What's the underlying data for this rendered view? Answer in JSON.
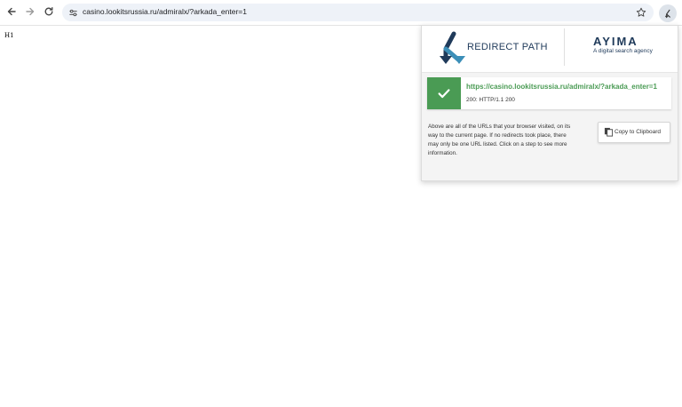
{
  "browser": {
    "url": "casino.lookitsrussia.ru/admiralx/?arkada_enter=1",
    "icons": {
      "back": "arrow-left-icon",
      "forward": "arrow-right-icon",
      "reload": "reload-icon",
      "site_info": "tune-icon",
      "bookmark": "star-icon",
      "extension": "redirect-path-icon"
    }
  },
  "page": {
    "text": "H1"
  },
  "popup": {
    "brand_name": "REDIRECT PATH",
    "partner_name": "AYIMA",
    "partner_tagline": "A digital search agency",
    "result": {
      "url": "https://casino.lookitsrussia.ru/admiralx/?arkada_enter=1",
      "status": "200: HTTP/1.1 200",
      "status_color": "#4a9b54"
    },
    "info_text": "Above are all of the URLs that your browser visited, on its way to the current page. If no redirects took place, there may only be one URL listed. Click on a step to see more information.",
    "copy_label": "Copy to Clipboard"
  }
}
